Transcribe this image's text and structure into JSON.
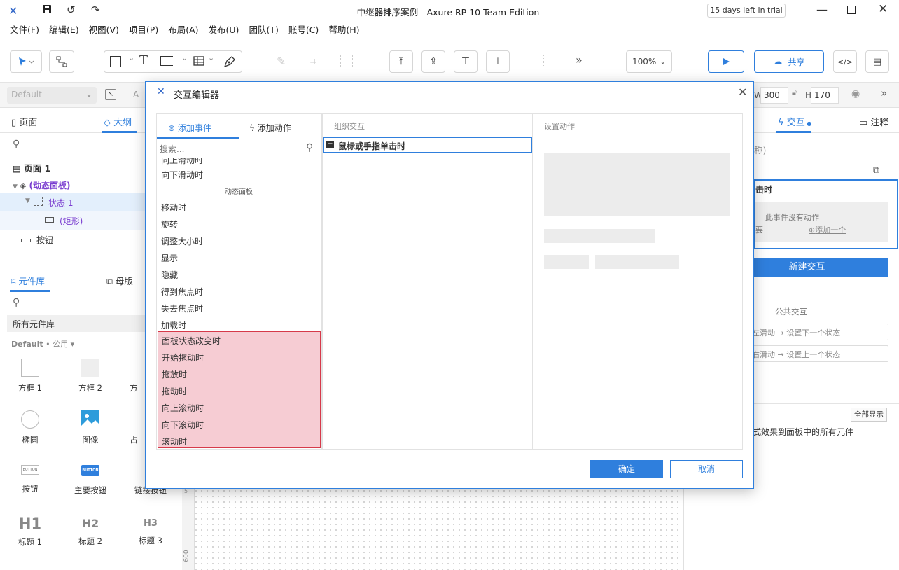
{
  "window": {
    "title": "中继器排序案例 - Axure RP 10 Team Edition",
    "trial_badge": "15 days left in trial"
  },
  "menu": [
    "文件(F)",
    "编辑(E)",
    "视图(V)",
    "项目(P)",
    "布局(A)",
    "发布(U)",
    "团队(T)",
    "账号(C)",
    "帮助(H)"
  ],
  "toolbar": {
    "zoom": "100%",
    "share_label": "共享"
  },
  "propbar": {
    "style_select": "Default",
    "style_select_right": "A",
    "w_label": "W",
    "w_value": "300",
    "h_label": "H",
    "h_value": "170"
  },
  "left_panel": {
    "tabs": [
      "页面",
      "大纲"
    ],
    "outline": [
      {
        "label": "页面 1"
      },
      {
        "label": "(动态面板)"
      },
      {
        "label": "状态 1"
      },
      {
        "label": "(矩形)"
      },
      {
        "label": "按钮"
      }
    ],
    "lib_tabs": [
      "元件库",
      "母版"
    ],
    "lib_select": "所有元件库",
    "lib_group_name": "Default",
    "lib_group_sep": "•",
    "lib_group_sub": "公用",
    "lib_items": [
      "方框 1",
      "方框 2",
      "方",
      "椭圆",
      "图像",
      "占",
      "按钮",
      "主要按钮",
      "链接按钮",
      "标题 1",
      "标题 2",
      "标题 3"
    ],
    "lib_glyphs": {
      "button_small": "BUTTON",
      "button_primary": "BUTTON",
      "h1": "H1",
      "h2": "H2",
      "h3": "H3"
    }
  },
  "right_panel": {
    "tabs": [
      "交互",
      "注释"
    ],
    "name_hint": "称)",
    "event_title": "击时",
    "no_action_text": "此事件没有动作",
    "left_hint": "要",
    "add_one": "添加一个",
    "new_interaction": "新建交互",
    "public_interactions_title": "公共交互",
    "public_items": [
      "左滑动 → 设置下一个状态",
      "右滑动 → 设置上一个状态"
    ],
    "show_all": "全部显示",
    "apply_text": "式效果到面板中的所有元件"
  },
  "canvas": {
    "ruler_label": "600",
    "ruler_mark": "5"
  },
  "dialog": {
    "title": "交互编辑器",
    "tab_add_event": "添加事件",
    "tab_add_action": "添加动作",
    "search_placeholder": "搜索...",
    "events_before": [
      "向上滑动时",
      "向下滑动时"
    ],
    "section_label": "动态面板",
    "events": [
      "移动时",
      "旋转",
      "调整大小时",
      "显示",
      "隐藏",
      "得到焦点时",
      "失去焦点时",
      "加载时"
    ],
    "events_highlighted": [
      "面板状态改变时",
      "开始拖动时",
      "拖放时",
      "拖动时",
      "向上滚动时",
      "向下滚动时",
      "滚动时"
    ],
    "organize_title": "组织交互",
    "selected_event": "鼠标或手指单击时",
    "set_action_title": "设置动作",
    "ok": "确定",
    "cancel": "取消"
  },
  "colors": {
    "accent": "#2f7fdd",
    "purple": "#7b3fd0",
    "highlight_bg": "#f6ccd3",
    "highlight_border": "#d63a4a"
  }
}
